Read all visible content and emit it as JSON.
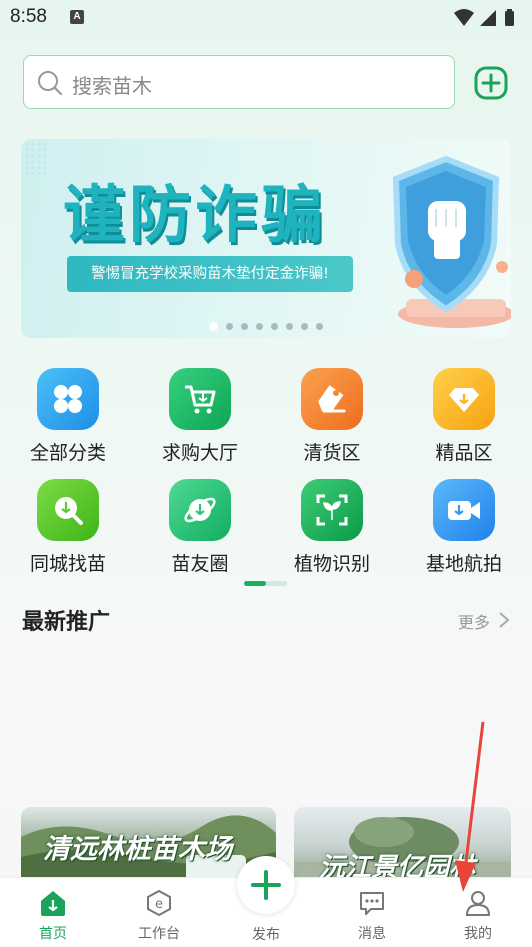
{
  "status_bar": {
    "time": "8:58",
    "notification_badge": "A"
  },
  "search": {
    "placeholder": "搜索苗木"
  },
  "banner": {
    "title": "谨防诈骗",
    "subtitle": "警惕冒充学校采购苗木垫付定金诈骗!",
    "dots_total": 8,
    "active_dot": 0
  },
  "categories": [
    {
      "label": "全部分类",
      "icon": "clover-icon",
      "color": "#2fa3f0"
    },
    {
      "label": "求购大厅",
      "icon": "cart-icon",
      "color": "#1db866"
    },
    {
      "label": "清货区",
      "icon": "tag-icon",
      "color": "#f48c2f"
    },
    {
      "label": "精品区",
      "icon": "diamond-icon",
      "color": "#f8b41a"
    },
    {
      "label": "同城找苗",
      "icon": "location-search-icon",
      "color": "#58c92f"
    },
    {
      "label": "苗友圈",
      "icon": "planet-icon",
      "color": "#2cc47a"
    },
    {
      "label": "植物识别",
      "icon": "scan-plant-icon",
      "color": "#1aae55"
    },
    {
      "label": "基地航拍",
      "icon": "video-camera-icon",
      "color": "#3498f5"
    }
  ],
  "section": {
    "title": "最新推广",
    "more": "更多"
  },
  "cards": [
    {
      "title": "清远林桩苗木场"
    },
    {
      "title": "沅江景亿园林"
    }
  ],
  "nav": {
    "home": "首页",
    "workbench": "工作台",
    "publish": "发布",
    "messages": "消息",
    "mine": "我的"
  },
  "colors": {
    "accent": "#1aa35a",
    "annotation": "#e8443a"
  }
}
